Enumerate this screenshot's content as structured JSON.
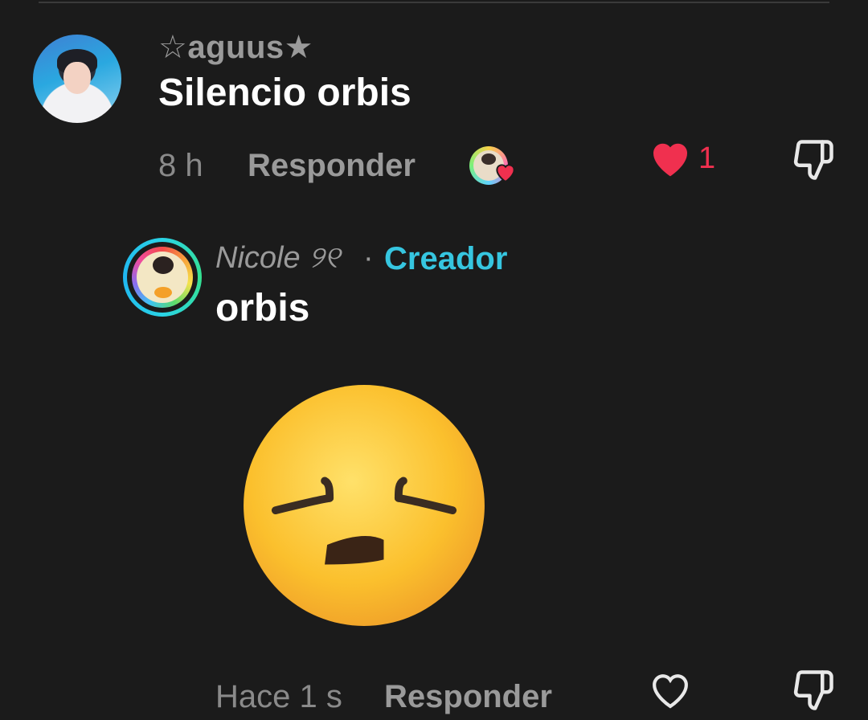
{
  "comments": [
    {
      "username": "☆aguus★",
      "text": "Silencio orbis",
      "time": "8 h",
      "reply_label": "Responder",
      "like_count": "1",
      "liked": true,
      "liked_by_creator": true
    },
    {
      "username": "Nicole ୨୧",
      "separator": "·",
      "badge": "Creador",
      "text": "orbis",
      "sticker": "weary-face-emoji",
      "time": "Hace 1 s",
      "reply_label": "Responder",
      "liked": false
    }
  ],
  "colors": {
    "background": "#1b1b1b",
    "like_red": "#f0304f",
    "creator_cyan": "#36c6e0",
    "muted_text": "#9a9a9a"
  },
  "icons": {
    "like_filled": "heart-icon",
    "like_outline": "heart-outline-icon",
    "dislike": "thumbs-down-icon"
  }
}
